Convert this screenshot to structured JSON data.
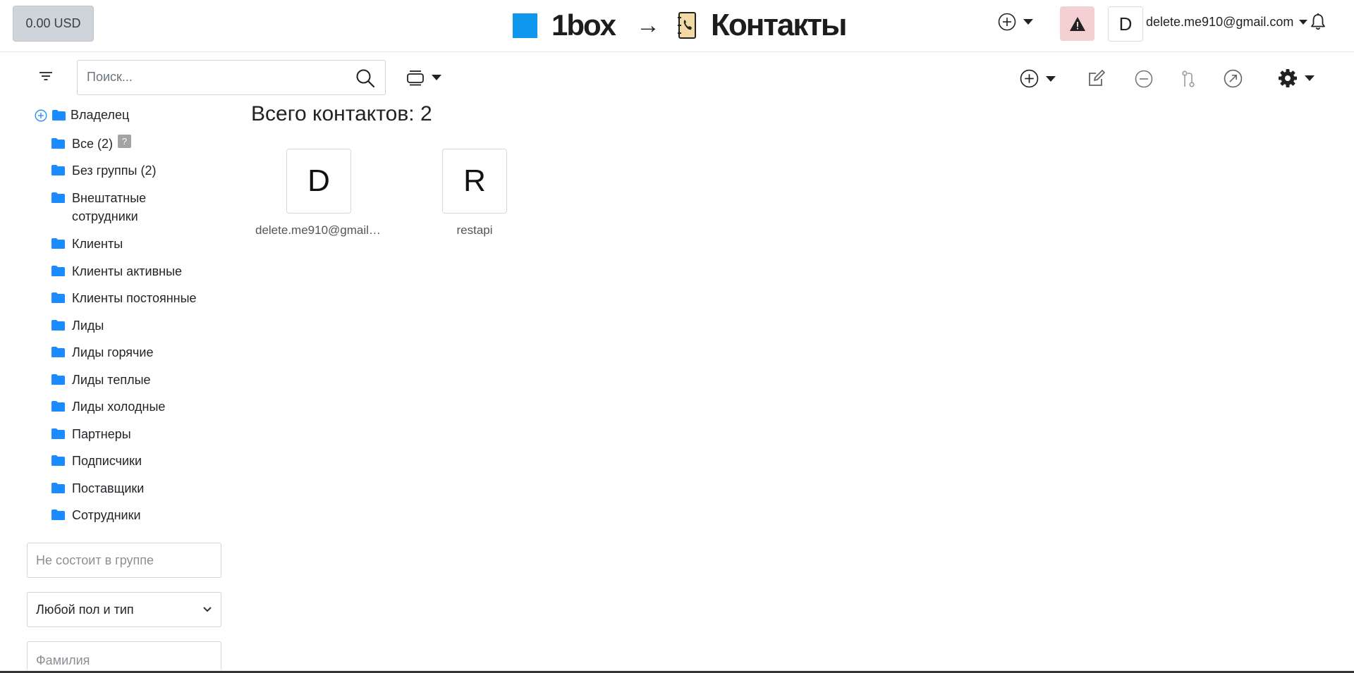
{
  "header": {
    "balance": "0.00 USD",
    "brand": "1box",
    "arrow": "→",
    "module": "Контакты",
    "user_initial": "D",
    "user_email": "delete.me910@gmail.com"
  },
  "toolbar": {
    "search_placeholder": "Поиск..."
  },
  "sidebar": {
    "root": "Владелец",
    "items": [
      {
        "label": "Все (2)",
        "badge": "?"
      },
      {
        "label": "Без группы (2)"
      },
      {
        "label": "Внештатные сотрудники"
      },
      {
        "label": "Клиенты"
      },
      {
        "label": "Клиенты активные"
      },
      {
        "label": "Клиенты постоянные"
      },
      {
        "label": "Лиды"
      },
      {
        "label": "Лиды горячие"
      },
      {
        "label": "Лиды теплые"
      },
      {
        "label": "Лиды холодные"
      },
      {
        "label": "Партнеры"
      },
      {
        "label": "Подписчики"
      },
      {
        "label": "Поставщики"
      },
      {
        "label": "Сотрудники"
      }
    ],
    "group_placeholder": "Не состоит в группе",
    "gender_select": "Любой пол и тип",
    "surname_placeholder": "Фамилия"
  },
  "main": {
    "total": "Всего контактов: 2",
    "contacts": [
      {
        "initial": "D",
        "name": "delete.me910@gmail.com"
      },
      {
        "initial": "R",
        "name": "restapi"
      }
    ]
  },
  "colors": {
    "brand": "#0f97ee",
    "folder": "#1a8cff",
    "alert_bg": "#f5d0d3"
  }
}
